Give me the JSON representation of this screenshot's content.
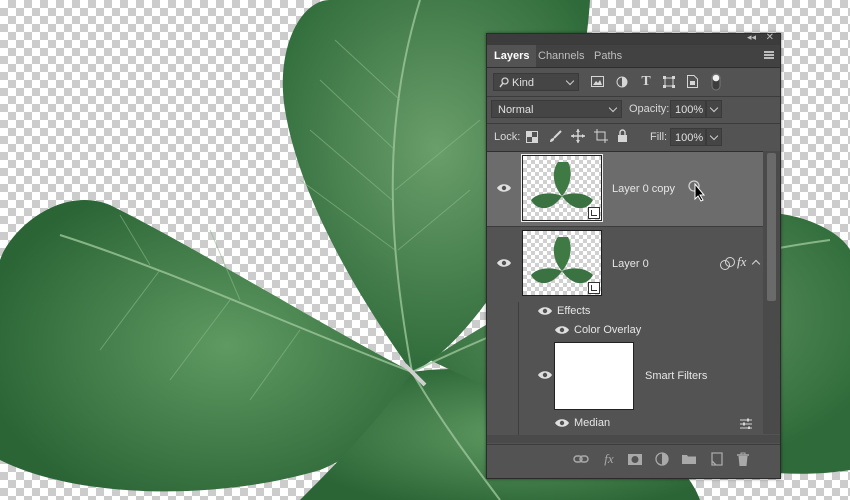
{
  "panel": {
    "tabs": [
      {
        "label": "Layers",
        "active": true
      },
      {
        "label": "Channels",
        "active": false
      },
      {
        "label": "Paths",
        "active": false
      }
    ],
    "filter": {
      "kind_label": "Kind"
    },
    "blend": {
      "mode": "Normal",
      "opacity_label": "Opacity:",
      "opacity_value": "100%"
    },
    "lock": {
      "label": "Lock:",
      "fill_label": "Fill:",
      "fill_value": "100%"
    },
    "layers": [
      {
        "name": "Layer 0 copy",
        "selected": true
      },
      {
        "name": "Layer 0",
        "selected": false,
        "fx_badge": "fx"
      }
    ],
    "effects": {
      "label": "Effects",
      "items": [
        "Color Overlay"
      ]
    },
    "smart_filters": {
      "label": "Smart Filters",
      "items": [
        "Median"
      ]
    }
  },
  "icons": {
    "eye": "eye-icon",
    "link": "link-icon",
    "fx": "fx-icon",
    "mask": "mask-icon",
    "adjustment": "adjustment-icon",
    "folder": "folder-icon",
    "new_layer": "new-layer-icon",
    "trash": "trash-icon"
  },
  "colors": {
    "panel_bg": "#535353",
    "selected_row": "#6c6c6c",
    "leaf": "#3f7a45"
  }
}
